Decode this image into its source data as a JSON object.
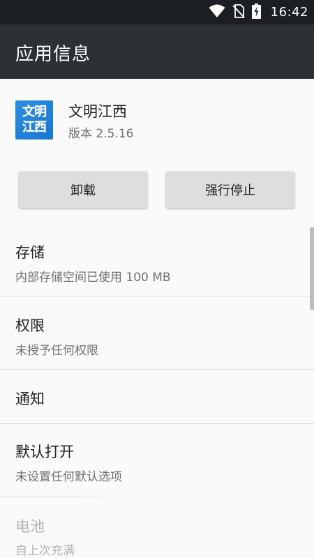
{
  "status_bar": {
    "time": "16:42",
    "icons": [
      "wifi-icon",
      "no-sim-icon",
      "battery-charging-icon"
    ]
  },
  "app_bar": {
    "title": "应用信息"
  },
  "app": {
    "icon_text_line1": "文明",
    "icon_text_line2": "江西",
    "name": "文明江西",
    "version": "版本 2.5.16"
  },
  "buttons": {
    "uninstall": "卸载",
    "force_stop": "强行停止"
  },
  "preferences": [
    {
      "title": "存储",
      "summary": "内部存储空间已使用 100 MB"
    },
    {
      "title": "权限",
      "summary": "未授予任何权限"
    },
    {
      "title": "通知",
      "summary": ""
    },
    {
      "title": "默认打开",
      "summary": "未设置任何默认选项"
    },
    {
      "title": "电池",
      "summary": "自上次充满"
    }
  ],
  "colors": {
    "status_bar": "#1b1f23",
    "app_bar": "#2c3135",
    "background": "#fafafa",
    "button": "#dedede",
    "primary_text": "#212121",
    "secondary_text": "#6f6f6f"
  }
}
